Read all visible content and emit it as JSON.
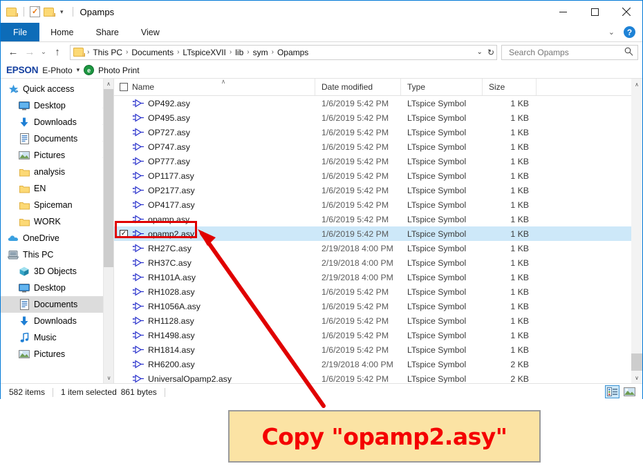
{
  "window": {
    "title": "Opamps",
    "quick_access": [
      "folder-icon",
      "properties-icon",
      "new-folder-icon",
      "customize-caret"
    ],
    "controls": {
      "minimize": "─",
      "maximize": "☐",
      "close": "✕"
    }
  },
  "ribbon": {
    "tabs": [
      {
        "label": "File",
        "active": true
      },
      {
        "label": "Home",
        "active": false
      },
      {
        "label": "Share",
        "active": false
      },
      {
        "label": "View",
        "active": false
      }
    ],
    "collapse_caret": "⌄",
    "help_label": "?"
  },
  "address": {
    "back": "←",
    "forward": "→",
    "recent": "⌄",
    "up": "↑",
    "breadcrumbs": [
      "This PC",
      "Documents",
      "LTspiceXVII",
      "lib",
      "sym",
      "Opamps"
    ],
    "separator": "›",
    "dropdown_caret": "⌄",
    "refresh": "↻"
  },
  "search": {
    "placeholder": "Search Opamps",
    "value": "",
    "icon": "⌕"
  },
  "epson_toolbar": {
    "logo": "EPSON",
    "app_label": "E-Photo",
    "caret": "▾",
    "print_icon_letter": "e",
    "print_label": "Photo Print"
  },
  "sidebar": {
    "items": [
      {
        "label": "Quick access",
        "icon": "star-icon",
        "level": 0,
        "pinned": false,
        "selected": false
      },
      {
        "label": "Desktop",
        "icon": "monitor-icon",
        "level": 1,
        "pinned": true,
        "selected": false
      },
      {
        "label": "Downloads",
        "icon": "download-icon",
        "level": 1,
        "pinned": true,
        "selected": false
      },
      {
        "label": "Documents",
        "icon": "document-icon",
        "level": 1,
        "pinned": true,
        "selected": false
      },
      {
        "label": "Pictures",
        "icon": "picture-icon",
        "level": 1,
        "pinned": true,
        "selected": false
      },
      {
        "label": "analysis",
        "icon": "folder-icon",
        "level": 1,
        "pinned": false,
        "selected": false
      },
      {
        "label": "EN",
        "icon": "folder-icon",
        "level": 1,
        "pinned": false,
        "selected": false
      },
      {
        "label": "Spiceman",
        "icon": "folder-icon",
        "level": 1,
        "pinned": false,
        "selected": false
      },
      {
        "label": "WORK",
        "icon": "folder-icon",
        "level": 1,
        "pinned": false,
        "selected": false
      },
      {
        "label": "OneDrive",
        "icon": "cloud-icon",
        "level": 0,
        "pinned": false,
        "selected": false
      },
      {
        "label": "This PC",
        "icon": "computer-icon",
        "level": 0,
        "pinned": false,
        "selected": false
      },
      {
        "label": "3D Objects",
        "icon": "cube-icon",
        "level": 1,
        "pinned": false,
        "selected": false
      },
      {
        "label": "Desktop",
        "icon": "monitor-icon",
        "level": 1,
        "pinned": false,
        "selected": false
      },
      {
        "label": "Documents",
        "icon": "document-icon",
        "level": 1,
        "pinned": false,
        "selected": true
      },
      {
        "label": "Downloads",
        "icon": "download-icon",
        "level": 1,
        "pinned": false,
        "selected": false
      },
      {
        "label": "Music",
        "icon": "music-icon",
        "level": 1,
        "pinned": false,
        "selected": false
      },
      {
        "label": "Pictures",
        "icon": "picture-icon",
        "level": 1,
        "pinned": false,
        "selected": false
      }
    ],
    "scroll_up": "∧",
    "scroll_down": "∨"
  },
  "filelist": {
    "columns": [
      "Name",
      "Date modified",
      "Type",
      "Size"
    ],
    "sort_indicator": "∧",
    "scroll_up": "∧",
    "scroll_down": "∨",
    "check_glyph": "✓",
    "rows": [
      {
        "name": "OP492.asy",
        "date": "1/6/2019 5:42 PM",
        "type": "LTspice Symbol",
        "size": "1 KB",
        "selected": false,
        "checked": false
      },
      {
        "name": "OP495.asy",
        "date": "1/6/2019 5:42 PM",
        "type": "LTspice Symbol",
        "size": "1 KB",
        "selected": false,
        "checked": false
      },
      {
        "name": "OP727.asy",
        "date": "1/6/2019 5:42 PM",
        "type": "LTspice Symbol",
        "size": "1 KB",
        "selected": false,
        "checked": false
      },
      {
        "name": "OP747.asy",
        "date": "1/6/2019 5:42 PM",
        "type": "LTspice Symbol",
        "size": "1 KB",
        "selected": false,
        "checked": false
      },
      {
        "name": "OP777.asy",
        "date": "1/6/2019 5:42 PM",
        "type": "LTspice Symbol",
        "size": "1 KB",
        "selected": false,
        "checked": false
      },
      {
        "name": "OP1177.asy",
        "date": "1/6/2019 5:42 PM",
        "type": "LTspice Symbol",
        "size": "1 KB",
        "selected": false,
        "checked": false
      },
      {
        "name": "OP2177.asy",
        "date": "1/6/2019 5:42 PM",
        "type": "LTspice Symbol",
        "size": "1 KB",
        "selected": false,
        "checked": false
      },
      {
        "name": "OP4177.asy",
        "date": "1/6/2019 5:42 PM",
        "type": "LTspice Symbol",
        "size": "1 KB",
        "selected": false,
        "checked": false
      },
      {
        "name": "opamp.asy",
        "date": "1/6/2019 5:42 PM",
        "type": "LTspice Symbol",
        "size": "1 KB",
        "selected": false,
        "checked": false
      },
      {
        "name": "opamp2.asy",
        "date": "1/6/2019 5:42 PM",
        "type": "LTspice Symbol",
        "size": "1 KB",
        "selected": true,
        "checked": true
      },
      {
        "name": "RH27C.asy",
        "date": "2/19/2018 4:00 PM",
        "type": "LTspice Symbol",
        "size": "1 KB",
        "selected": false,
        "checked": false
      },
      {
        "name": "RH37C.asy",
        "date": "2/19/2018 4:00 PM",
        "type": "LTspice Symbol",
        "size": "1 KB",
        "selected": false,
        "checked": false
      },
      {
        "name": "RH101A.asy",
        "date": "2/19/2018 4:00 PM",
        "type": "LTspice Symbol",
        "size": "1 KB",
        "selected": false,
        "checked": false
      },
      {
        "name": "RH1028.asy",
        "date": "1/6/2019 5:42 PM",
        "type": "LTspice Symbol",
        "size": "1 KB",
        "selected": false,
        "checked": false
      },
      {
        "name": "RH1056A.asy",
        "date": "1/6/2019 5:42 PM",
        "type": "LTspice Symbol",
        "size": "1 KB",
        "selected": false,
        "checked": false
      },
      {
        "name": "RH1128.asy",
        "date": "1/6/2019 5:42 PM",
        "type": "LTspice Symbol",
        "size": "1 KB",
        "selected": false,
        "checked": false
      },
      {
        "name": "RH1498.asy",
        "date": "1/6/2019 5:42 PM",
        "type": "LTspice Symbol",
        "size": "1 KB",
        "selected": false,
        "checked": false
      },
      {
        "name": "RH1814.asy",
        "date": "1/6/2019 5:42 PM",
        "type": "LTspice Symbol",
        "size": "1 KB",
        "selected": false,
        "checked": false
      },
      {
        "name": "RH6200.asy",
        "date": "2/19/2018 4:00 PM",
        "type": "LTspice Symbol",
        "size": "2 KB",
        "selected": false,
        "checked": false
      },
      {
        "name": "UniversalOpamp2.asy",
        "date": "1/6/2019 5:42 PM",
        "type": "LTspice Symbol",
        "size": "2 KB",
        "selected": false,
        "checked": false
      }
    ]
  },
  "statusbar": {
    "item_count": "582 items",
    "selection": "1 item selected",
    "selection_size": "861 bytes",
    "view_details": "details-view",
    "view_large_icons": "large-icons-view"
  },
  "annotation": {
    "callout_text": "Copy \"opamp2.asy\"",
    "callout_bg": "#fbe3a4",
    "callout_border": "#9a9a9a",
    "highlight_color": "#e00000",
    "text_color": "#f40000"
  }
}
